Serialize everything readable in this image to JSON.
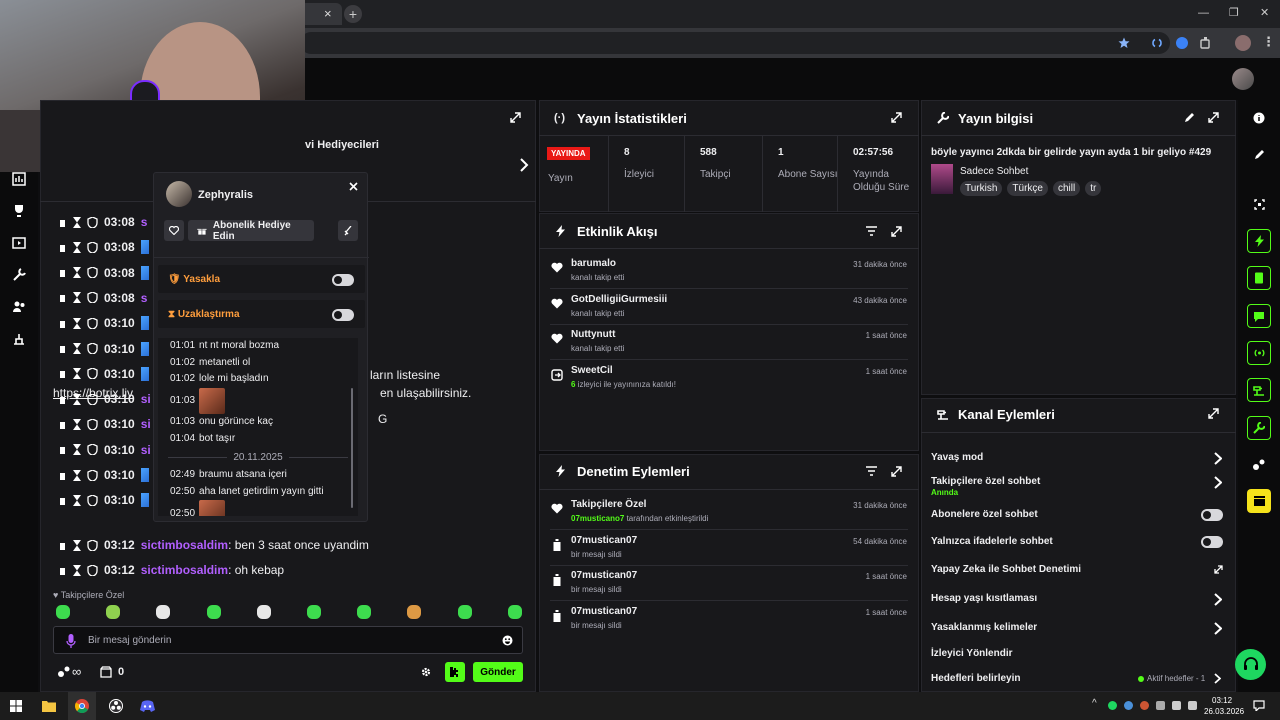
{
  "browser": {
    "tab_close": "×",
    "new_tab": "+",
    "win_min": "—",
    "win_max": "❐",
    "win_close": "✕"
  },
  "stats": {
    "title": "Yayın İstatistikleri",
    "live_badge": "YAYINDA",
    "live_label": "Yayın",
    "items": [
      {
        "value": "8",
        "label": "İzleyici"
      },
      {
        "value": "588",
        "label": "Takipçi"
      },
      {
        "value": "1",
        "label": "Abone Sayısı"
      },
      {
        "value": "02:57:56",
        "label": "Yayında Olduğu Süre"
      }
    ]
  },
  "stream_info": {
    "title": "Yayın bilgisi",
    "stream_title": "böyle yayıncı 2dkda bir gelirde yayın ayda 1 bir geliyo #429",
    "category": "Sadece Sohbet",
    "tags": [
      "Turkish",
      "Türkçe",
      "chill",
      "tr"
    ]
  },
  "activity": {
    "title": "Etkinlik Akışı",
    "items": [
      {
        "user": "barumalo",
        "desc": "kanalı takip etti",
        "time": "31 dakika önce"
      },
      {
        "user": "GotDelligiiGurmesiii",
        "desc": "kanalı takip etti",
        "time": "43 dakika önce"
      },
      {
        "user": "Nuttynutt",
        "desc": "kanalı takip etti",
        "time": "1 saat önce"
      },
      {
        "user": "SweetCil",
        "desc_count": "6",
        "desc": " izleyici ile yayınınıza katıldı!",
        "time": "1 saat önce"
      }
    ]
  },
  "mod_actions": {
    "title": "Denetim Eylemleri",
    "items": [
      {
        "user": "Takipçilere Özel",
        "sub_user": "07musticano7",
        "desc": " tarafından etkinleştirildi",
        "time": "31 dakika önce"
      },
      {
        "user": "07mustican07",
        "desc": "bir mesajı sildi",
        "time": "54 dakika önce"
      },
      {
        "user": "07mustican07",
        "desc": "bir mesajı sildi",
        "time": "1 saat önce"
      },
      {
        "user": "07mustican07",
        "desc": "bir mesajı sildi",
        "time": "1 saat önce"
      }
    ]
  },
  "channel_actions": {
    "title": "Kanal Eylemleri",
    "items": [
      {
        "label": "Yavaş mod"
      },
      {
        "label": "Takipçilere özel sohbet",
        "sub": "Anında"
      },
      {
        "label": "Abonelere özel sohbet"
      },
      {
        "label": "Yalnızca ifadelerle sohbet"
      },
      {
        "label": "Yapay Zeka ile Sohbet Denetimi"
      },
      {
        "label": "Hesap yaşı kısıtlaması"
      },
      {
        "label": "Yasaklanmış kelimeler"
      },
      {
        "label": "İzleyici Yönlendir"
      },
      {
        "label": "Hedefleri belirleyin",
        "extra": "Aktif hedefler - 1"
      }
    ]
  },
  "chat": {
    "gift_header": "vi Hediyecileri",
    "info_text_1": "ların listesine",
    "info_text_2": "en ulaşabilirsiniz.",
    "info_link": "https://botrix.liv",
    "info_g": "G",
    "rows": [
      {
        "time": "03:08",
        "prefix": "s"
      },
      {
        "time": "03:08",
        "prefix": ""
      },
      {
        "time": "03:08",
        "prefix": ""
      },
      {
        "time": "03:08",
        "prefix": "s"
      },
      {
        "time": "03:10",
        "prefix": ""
      },
      {
        "time": "03:10",
        "prefix": ""
      },
      {
        "time": "03:10",
        "prefix": ""
      },
      {
        "time": "03:10",
        "prefix": "si"
      },
      {
        "time": "03:10",
        "prefix": "si"
      },
      {
        "time": "03:10",
        "prefix": "si"
      },
      {
        "time": "03:10",
        "prefix": ""
      },
      {
        "time": "03:10",
        "prefix": ""
      }
    ],
    "messages": [
      {
        "time": "03:12",
        "user": "sictimbosaldim",
        "text": ": ben 3 saat once uyandim"
      },
      {
        "time": "03:12",
        "user": "sictimbosaldim",
        "text": ": oh kebap"
      }
    ],
    "followers_only": "Takipçilere Özel",
    "input_placeholder": "Bir mesaj gönderin",
    "infinity": "∞",
    "count": "0",
    "send": "Gönder"
  },
  "user_card": {
    "username": "Zephyralis",
    "gift_button": "Abonelik Hediye Edin",
    "ban_label": "Yasakla",
    "timeout_label": "Uzaklaştırma",
    "history": [
      {
        "time": "01:01",
        "text": "nt nt moral bozma"
      },
      {
        "time": "01:02",
        "text": "metanetli ol"
      },
      {
        "time": "01:02",
        "text": "lole mi başladın"
      },
      {
        "time": "01:03",
        "text": "",
        "emote": true
      },
      {
        "time": "01:03",
        "text": "onu görünce kaç"
      },
      {
        "time": "01:04",
        "text": "bot taşır"
      }
    ],
    "date_sep": "20.11.2025",
    "history2": [
      {
        "time": "02:49",
        "text": "braumu atsana içeri"
      },
      {
        "time": "02:50",
        "text": "aha lanet getirdim yayın gitti"
      },
      {
        "time": "02:50",
        "text": "",
        "emote": true
      }
    ]
  },
  "taskbar": {
    "time": "03:12",
    "date": "26.03.2026"
  },
  "colors": {
    "accent": "#53fc18",
    "live": "#e91916",
    "bg": "#0e0e10",
    "panel": "#18181b"
  }
}
